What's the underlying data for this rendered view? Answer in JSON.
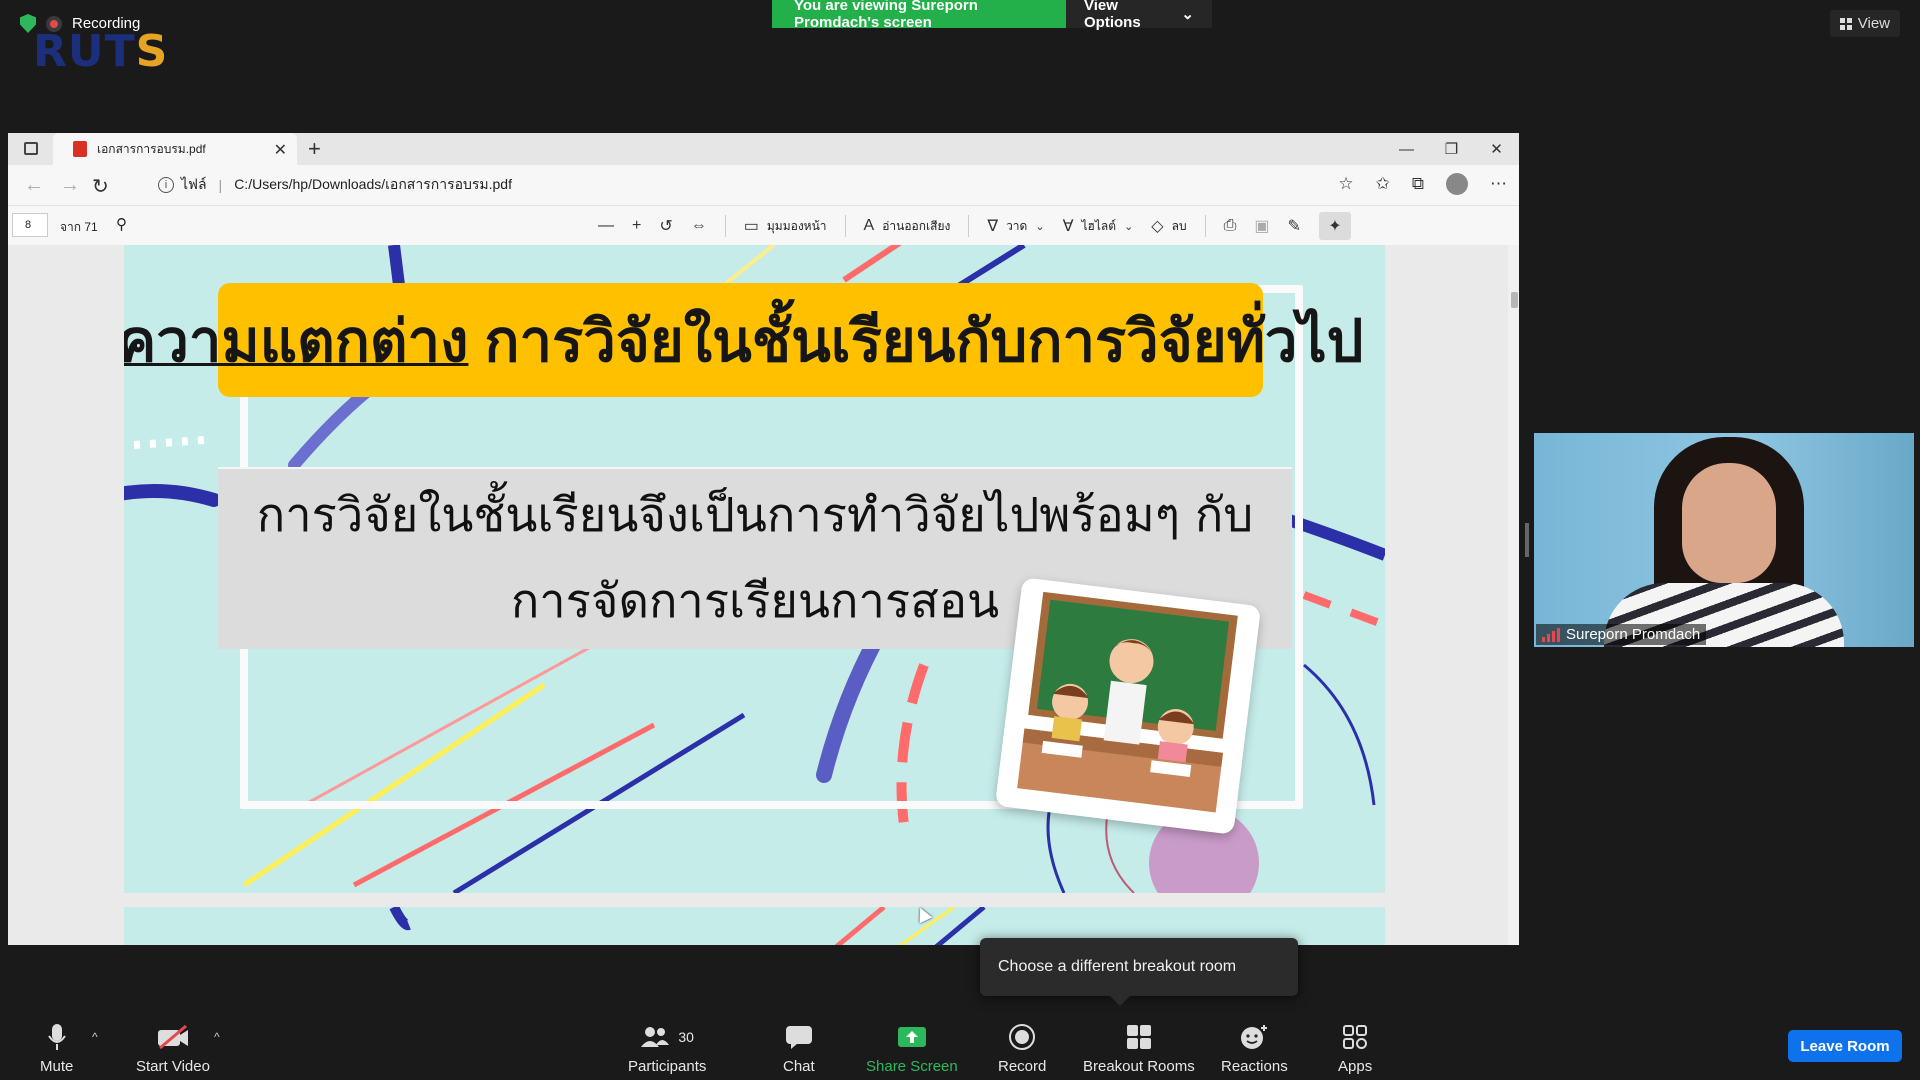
{
  "zoom": {
    "recording_label": "Recording",
    "logo_text_a": "RUT",
    "logo_text_b": "S",
    "viewing_banner": "You are viewing Sureporn Promdach's screen",
    "view_options": "View Options",
    "view_button": "View",
    "participant_name": "Sureporn Promdach",
    "tooltip": "Choose a different breakout room",
    "leave_button": "Leave Room",
    "participant_count": "30",
    "toolbar": [
      {
        "id": "mute",
        "label": "Mute",
        "icon": "microphone-icon"
      },
      {
        "id": "video",
        "label": "Start Video",
        "icon": "video-off-icon"
      },
      {
        "id": "participants",
        "label": "Participants",
        "icon": "participants-icon"
      },
      {
        "id": "chat",
        "label": "Chat",
        "icon": "chat-icon"
      },
      {
        "id": "share",
        "label": "Share Screen",
        "icon": "share-screen-icon"
      },
      {
        "id": "record",
        "label": "Record",
        "icon": "record-icon"
      },
      {
        "id": "breakout",
        "label": "Breakout Rooms",
        "icon": "breakout-rooms-icon"
      },
      {
        "id": "reactions",
        "label": "Reactions",
        "icon": "reactions-icon"
      },
      {
        "id": "apps",
        "label": "Apps",
        "icon": "apps-icon"
      }
    ]
  },
  "browser": {
    "tab_title": "เอกสารการอบรม.pdf",
    "address_prefix": "ไฟล์",
    "address_url": "C:/Users/hp/Downloads/เอกสารการอบรม.pdf",
    "page_number": "8",
    "page_total": "จาก 71",
    "tools": {
      "page_view": "มุมมองหน้า",
      "read_aloud": "อ่านออกเสียง",
      "draw": "วาด",
      "highlight": "ไฮไลต์",
      "erase": "ลบ"
    }
  },
  "slide": {
    "title_underlined": "ความแตกต่าง",
    "title_rest": "การวิจัยในชั้นเรียนกับการวิจัยทั่วไป",
    "body_line1": "การวิจัยในชั้นเรียนจึงเป็นการทำวิจัยไปพร้อมๆ กับ",
    "body_line2": "การจัดการเรียนการสอน"
  },
  "colors": {
    "zoom_green": "#23b04a",
    "leave_blue": "#0e72ed",
    "banner_yellow": "#ffc000",
    "slide_bg": "#c5ece9"
  }
}
